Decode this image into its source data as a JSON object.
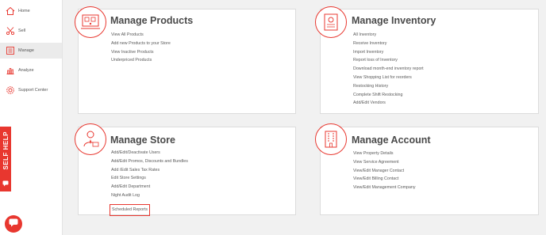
{
  "sidebar": {
    "items": [
      {
        "label": "Home",
        "icon": "house-icon"
      },
      {
        "label": "Sell",
        "icon": "scissors-icon"
      },
      {
        "label": "Manage",
        "icon": "manage-grid-icon"
      },
      {
        "label": "Analyze",
        "icon": "bar-chart-icon"
      },
      {
        "label": "Support Center",
        "icon": "gear-icon"
      }
    ],
    "active": "Manage"
  },
  "self_help": {
    "label": "SELF HELP"
  },
  "colors": {
    "accent": "#e8372f",
    "background": "#f1f1f1",
    "title": "#4a4a4a"
  },
  "cards": {
    "products": {
      "title": "Manage Products",
      "icon": "products-icon",
      "links": [
        "View All Products",
        "Add new Products to your Store",
        "View Inactive Products",
        "Underpriced Products"
      ]
    },
    "inventory": {
      "title": "Manage Inventory",
      "icon": "inventory-icon",
      "links": [
        "All Inventory",
        "Receive Inventory",
        "Import Inventory",
        "Report loss of Inventory",
        "Download month-end inventory report",
        "View Shopping List for reorders",
        "Restocking History",
        "Complete Shift Restocking",
        "Add/Edit Vendors"
      ]
    },
    "store": {
      "title": "Manage Store",
      "icon": "store-manager-icon",
      "links": [
        "Add/Edit/Deactivate Users",
        "Add/Edit Promos, Discounts and Bundles",
        "Add /Edit Sales Tax Rates",
        "Edit Store Settings",
        "Add/Edit Department",
        "Night Audit Log",
        "Scheduled Reports"
      ],
      "highlighted": "Scheduled Reports"
    },
    "account": {
      "title": "Manage Account",
      "icon": "account-building-icon",
      "links": [
        "View Property Details",
        "View Service Agreement",
        "View/Edit Manager Contact",
        "View/Edit Billing Contact",
        "View/Edit Management Company"
      ]
    }
  }
}
